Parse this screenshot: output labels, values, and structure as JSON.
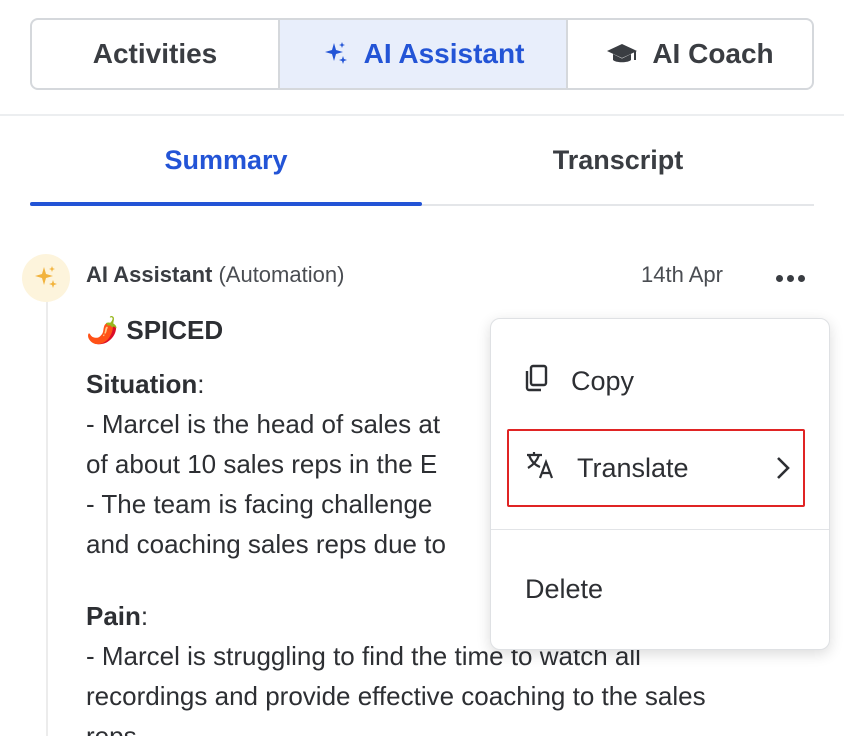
{
  "top_tabs": [
    {
      "label": "Activities"
    },
    {
      "label": "AI Assistant",
      "icon": "sparkle-icon",
      "active": true
    },
    {
      "label": "AI Coach",
      "icon": "graduation-cap-icon"
    }
  ],
  "sub_tabs": [
    {
      "label": "Summary",
      "active": true
    },
    {
      "label": "Transcript"
    }
  ],
  "message": {
    "author": "AI Assistant",
    "role": "(Automation)",
    "date": "14th Apr",
    "title_emoji": "🌶️",
    "title": "SPICED",
    "situation_label": "Situation",
    "situation_lines": [
      "- Marcel is the head of sales at",
      "of about 10 sales reps in the E",
      "- The team is facing challenge",
      "and coaching sales reps due to"
    ],
    "pain_label": "Pain",
    "pain_lines": [
      "- Marcel is struggling to find the time to watch all",
      "recordings and provide effective coaching to the sales",
      "reps."
    ]
  },
  "context_menu": {
    "items": [
      {
        "label": "Copy",
        "icon": "copy-icon"
      },
      {
        "label": "Translate",
        "icon": "translate-icon",
        "submenu": true,
        "highlighted": true
      },
      {
        "label": "Delete"
      }
    ]
  },
  "colors": {
    "accent": "#2354d6",
    "active_tab_bg": "#e8eefb",
    "highlight_border": "#e02424",
    "sparkle": "#f2b33d"
  }
}
